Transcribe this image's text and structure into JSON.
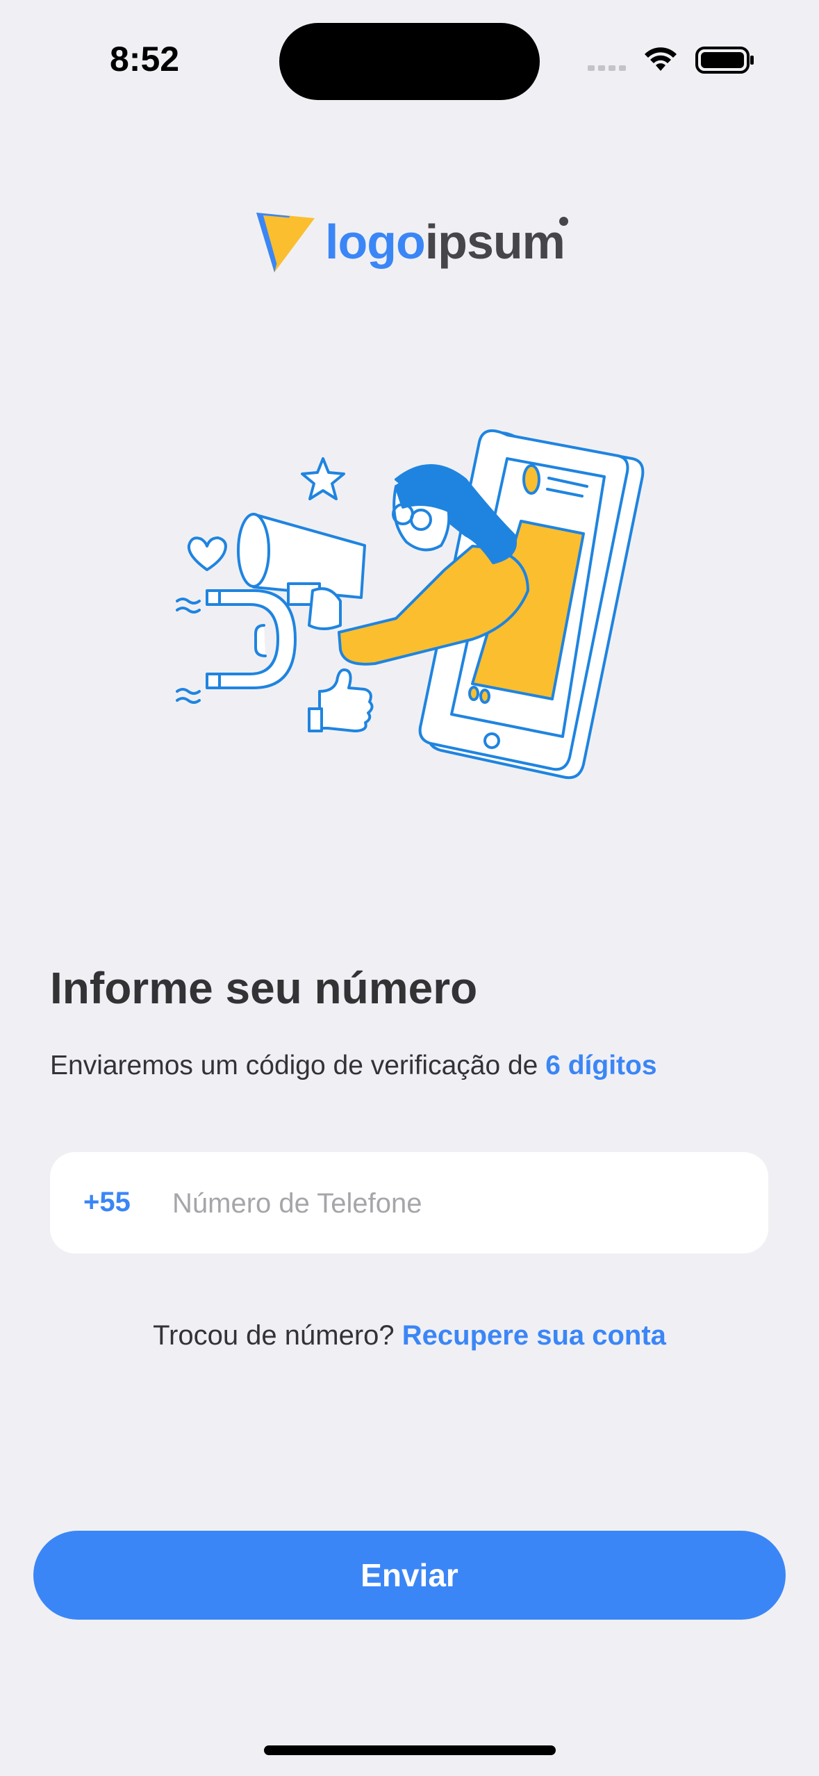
{
  "status_bar": {
    "time": "8:52"
  },
  "logo": {
    "part1": "logo",
    "part2": "ipsum",
    "colors": {
      "accent": "#3b86f6",
      "dark": "#45454a",
      "yellow": "#fbbe2e"
    }
  },
  "main": {
    "title": "Informe seu número",
    "subtitle_prefix": "Enviaremos um código de verificação de ",
    "subtitle_highlight": "6 dígitos",
    "phone": {
      "country_code": "+55",
      "placeholder": "Número de Telefone",
      "value": ""
    },
    "recover_prompt": "Trocou de número? ",
    "recover_link": "Recupere sua conta",
    "submit_label": "Enviar"
  },
  "colors": {
    "background": "#f0f0f4",
    "primary": "#3b86f6",
    "text": "#333336",
    "placeholder": "#a5a5aa"
  },
  "icons": [
    "wifi-icon",
    "battery-icon",
    "signal-icon",
    "logo-mark-icon"
  ]
}
